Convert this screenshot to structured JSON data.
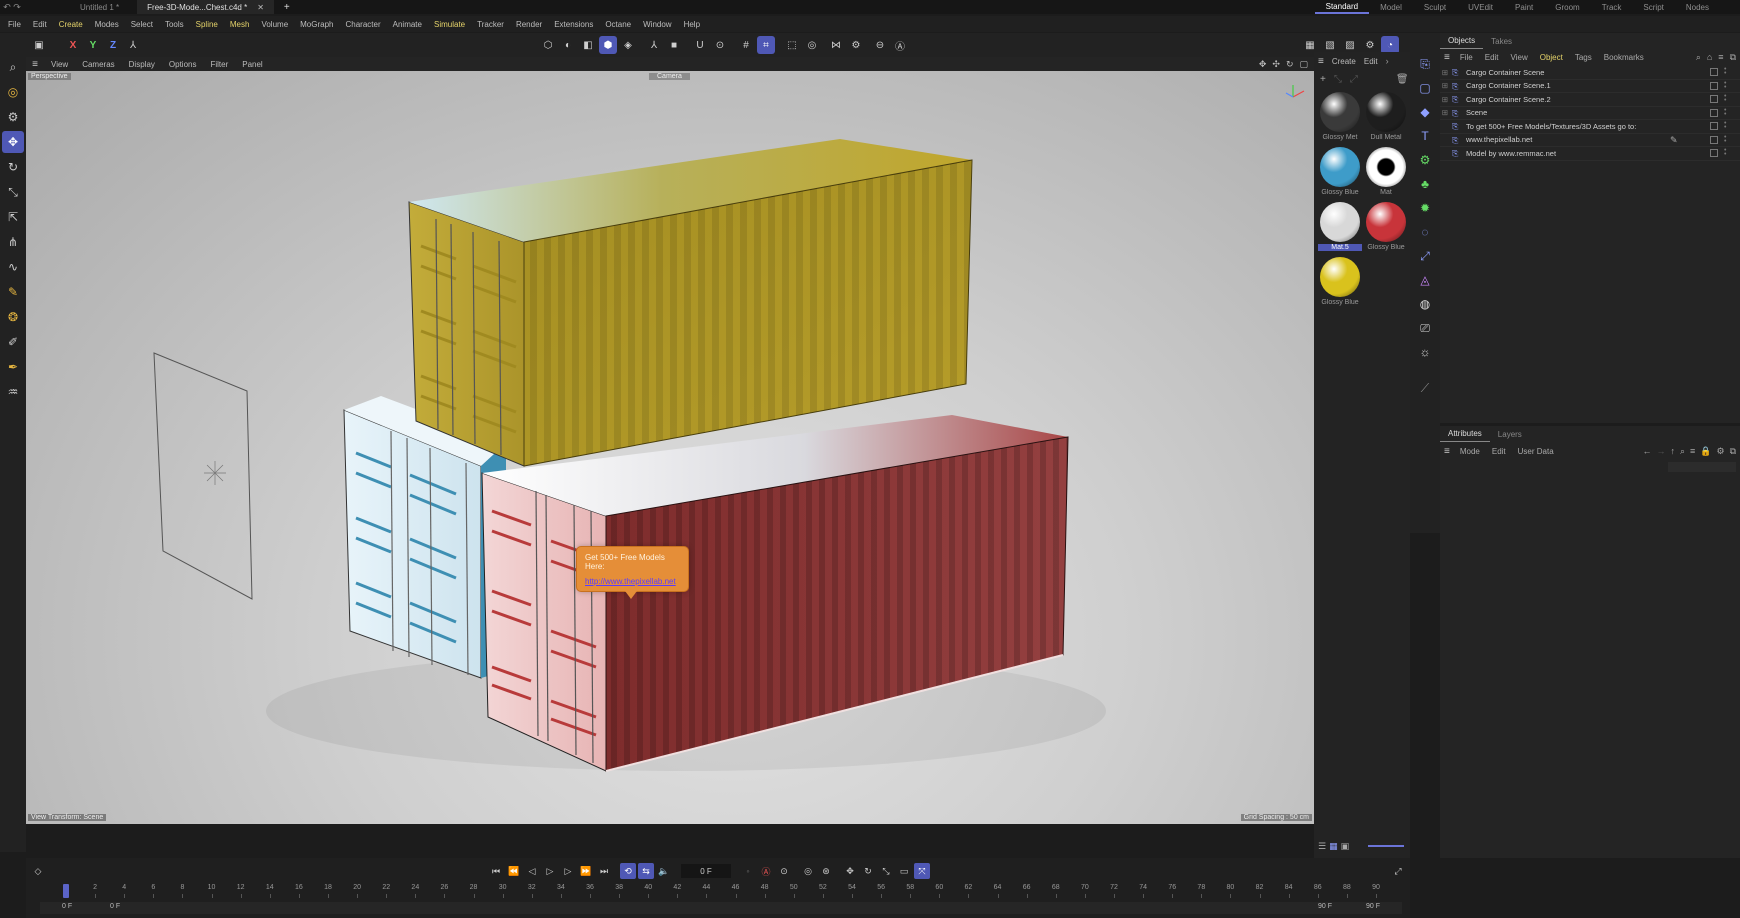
{
  "titlebar": {
    "tabs": [
      {
        "label": "Untitled 1 *"
      },
      {
        "label": "Free-3D-Mode...Chest.c4d *"
      }
    ],
    "close_glyph": "✕",
    "add_glyph": "+",
    "layouts": [
      "Standard",
      "Model",
      "Sculpt",
      "UVEdit",
      "Paint",
      "Groom",
      "Track",
      "Script",
      "Nodes"
    ]
  },
  "menubar": {
    "items": [
      "File",
      "Edit",
      "Create",
      "Modes",
      "Select",
      "Tools",
      "Spline",
      "Mesh",
      "Volume",
      "MoGraph",
      "Character",
      "Animate",
      "Simulate",
      "Tracker",
      "Render",
      "Extensions",
      "Octane",
      "Window",
      "Help"
    ],
    "highlighted": [
      "Create",
      "Spline",
      "Mesh",
      "Simulate"
    ]
  },
  "toolbar": {
    "axes": [
      "X",
      "Y",
      "Z"
    ]
  },
  "viewport": {
    "menu": [
      "View",
      "Cameras",
      "Display",
      "Options",
      "Filter",
      "Panel"
    ],
    "projection_label": "Perspective",
    "camera_label": "Camera",
    "view_transform": "View Transform: Scene",
    "grid_spacing": "Grid Spacing : 50 cm",
    "bubble_line1": "Get 500+ Free Models Here:",
    "bubble_link": "http://www.thepixellab.net"
  },
  "timeline": {
    "current_frame": "0 F",
    "ticks": [
      0,
      2,
      4,
      6,
      8,
      10,
      12,
      14,
      16,
      18,
      20,
      22,
      24,
      26,
      28,
      30,
      32,
      34,
      36,
      38,
      40,
      42,
      44,
      46,
      48,
      50,
      52,
      54,
      56,
      58,
      60,
      62,
      64,
      66,
      68,
      70,
      72,
      74,
      76,
      78,
      80,
      82,
      84,
      86,
      88,
      90
    ],
    "start_a": "0 F",
    "start_b": "0 F",
    "end_a": "90 F",
    "end_b": "90 F",
    "max_frame": 90
  },
  "materials": {
    "header": [
      "Create",
      "Edit"
    ],
    "items": [
      {
        "label": "Glossy Met",
        "color": "#3a3a3a"
      },
      {
        "label": "Dull Metal",
        "color": "#1e1e1e"
      },
      {
        "label": "Glossy Blue",
        "color": "#3e9cc9"
      },
      {
        "label": "Mat",
        "color": "#ffffff"
      },
      {
        "label": "Mat.5",
        "color": "#d8d8d8",
        "selected": true
      },
      {
        "label": "Glossy Blue",
        "color": "#c8343a"
      },
      {
        "label": "Glossy Blue",
        "color": "#d9c21d"
      }
    ]
  },
  "objects": {
    "tabs": [
      "Objects",
      "Takes"
    ],
    "menu": [
      "File",
      "Edit",
      "View",
      "Object",
      "Tags",
      "Bookmarks"
    ],
    "highlighted_menu": "Object",
    "rows": [
      {
        "name": "Cargo Container Scene",
        "expandable": true
      },
      {
        "name": "Cargo Container Scene.1",
        "expandable": true
      },
      {
        "name": "Cargo Container Scene.2",
        "expandable": true
      },
      {
        "name": "Scene",
        "expandable": true
      },
      {
        "name": "To get 500+ Free Models/Textures/3D Assets go to:",
        "expandable": false
      },
      {
        "name": "www.thepixellab.net",
        "expandable": false
      },
      {
        "name": "Model by www.remmac.net",
        "expandable": false
      }
    ]
  },
  "attributes": {
    "tabs": [
      "Attributes",
      "Layers"
    ],
    "menu": [
      "Mode",
      "Edit",
      "User Data"
    ]
  },
  "colors": {
    "accent": "#4f58b5",
    "yellow_container": "#b9a12a",
    "red_container": "#8c3535",
    "blue_container": "#d6e8f2"
  }
}
